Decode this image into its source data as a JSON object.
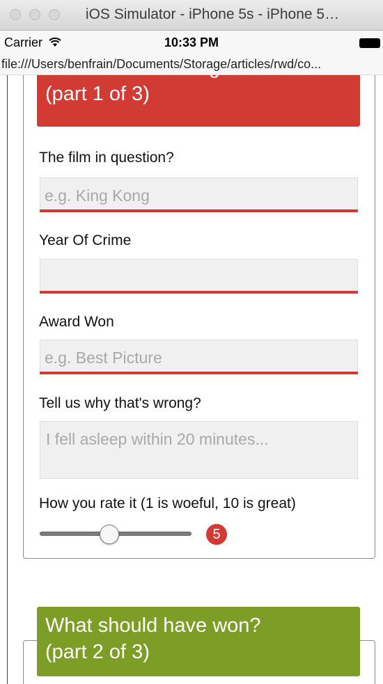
{
  "window": {
    "title": "iOS Simulator - iPhone 5s - iPhone 5…"
  },
  "status_bar": {
    "carrier": "Carrier",
    "time": "10:33 PM"
  },
  "url_bar": {
    "url": "file:///Users/benfrain/Documents/Storage/articles/rwd/co..."
  },
  "form": {
    "section1": {
      "legend_line1": "About the offending film",
      "legend_line2": "(part 1 of 3)",
      "color": "#d23a34"
    },
    "film": {
      "label": "The film in question?",
      "placeholder": "e.g. King Kong"
    },
    "year": {
      "label": "Year Of Crime",
      "placeholder": ""
    },
    "award": {
      "label": "Award Won",
      "placeholder": "e.g. Best Picture"
    },
    "reason": {
      "label": "Tell us why that's wrong?",
      "placeholder": "I fell asleep within 20 minutes..."
    },
    "rating": {
      "label": "How you rate it (1 is woeful, 10 is great)",
      "value": "5",
      "min": 1,
      "max": 10
    },
    "section2": {
      "legend_line1": "What should have won?",
      "legend_line2": "(part 2 of 3)",
      "color": "#7d9e26"
    }
  }
}
